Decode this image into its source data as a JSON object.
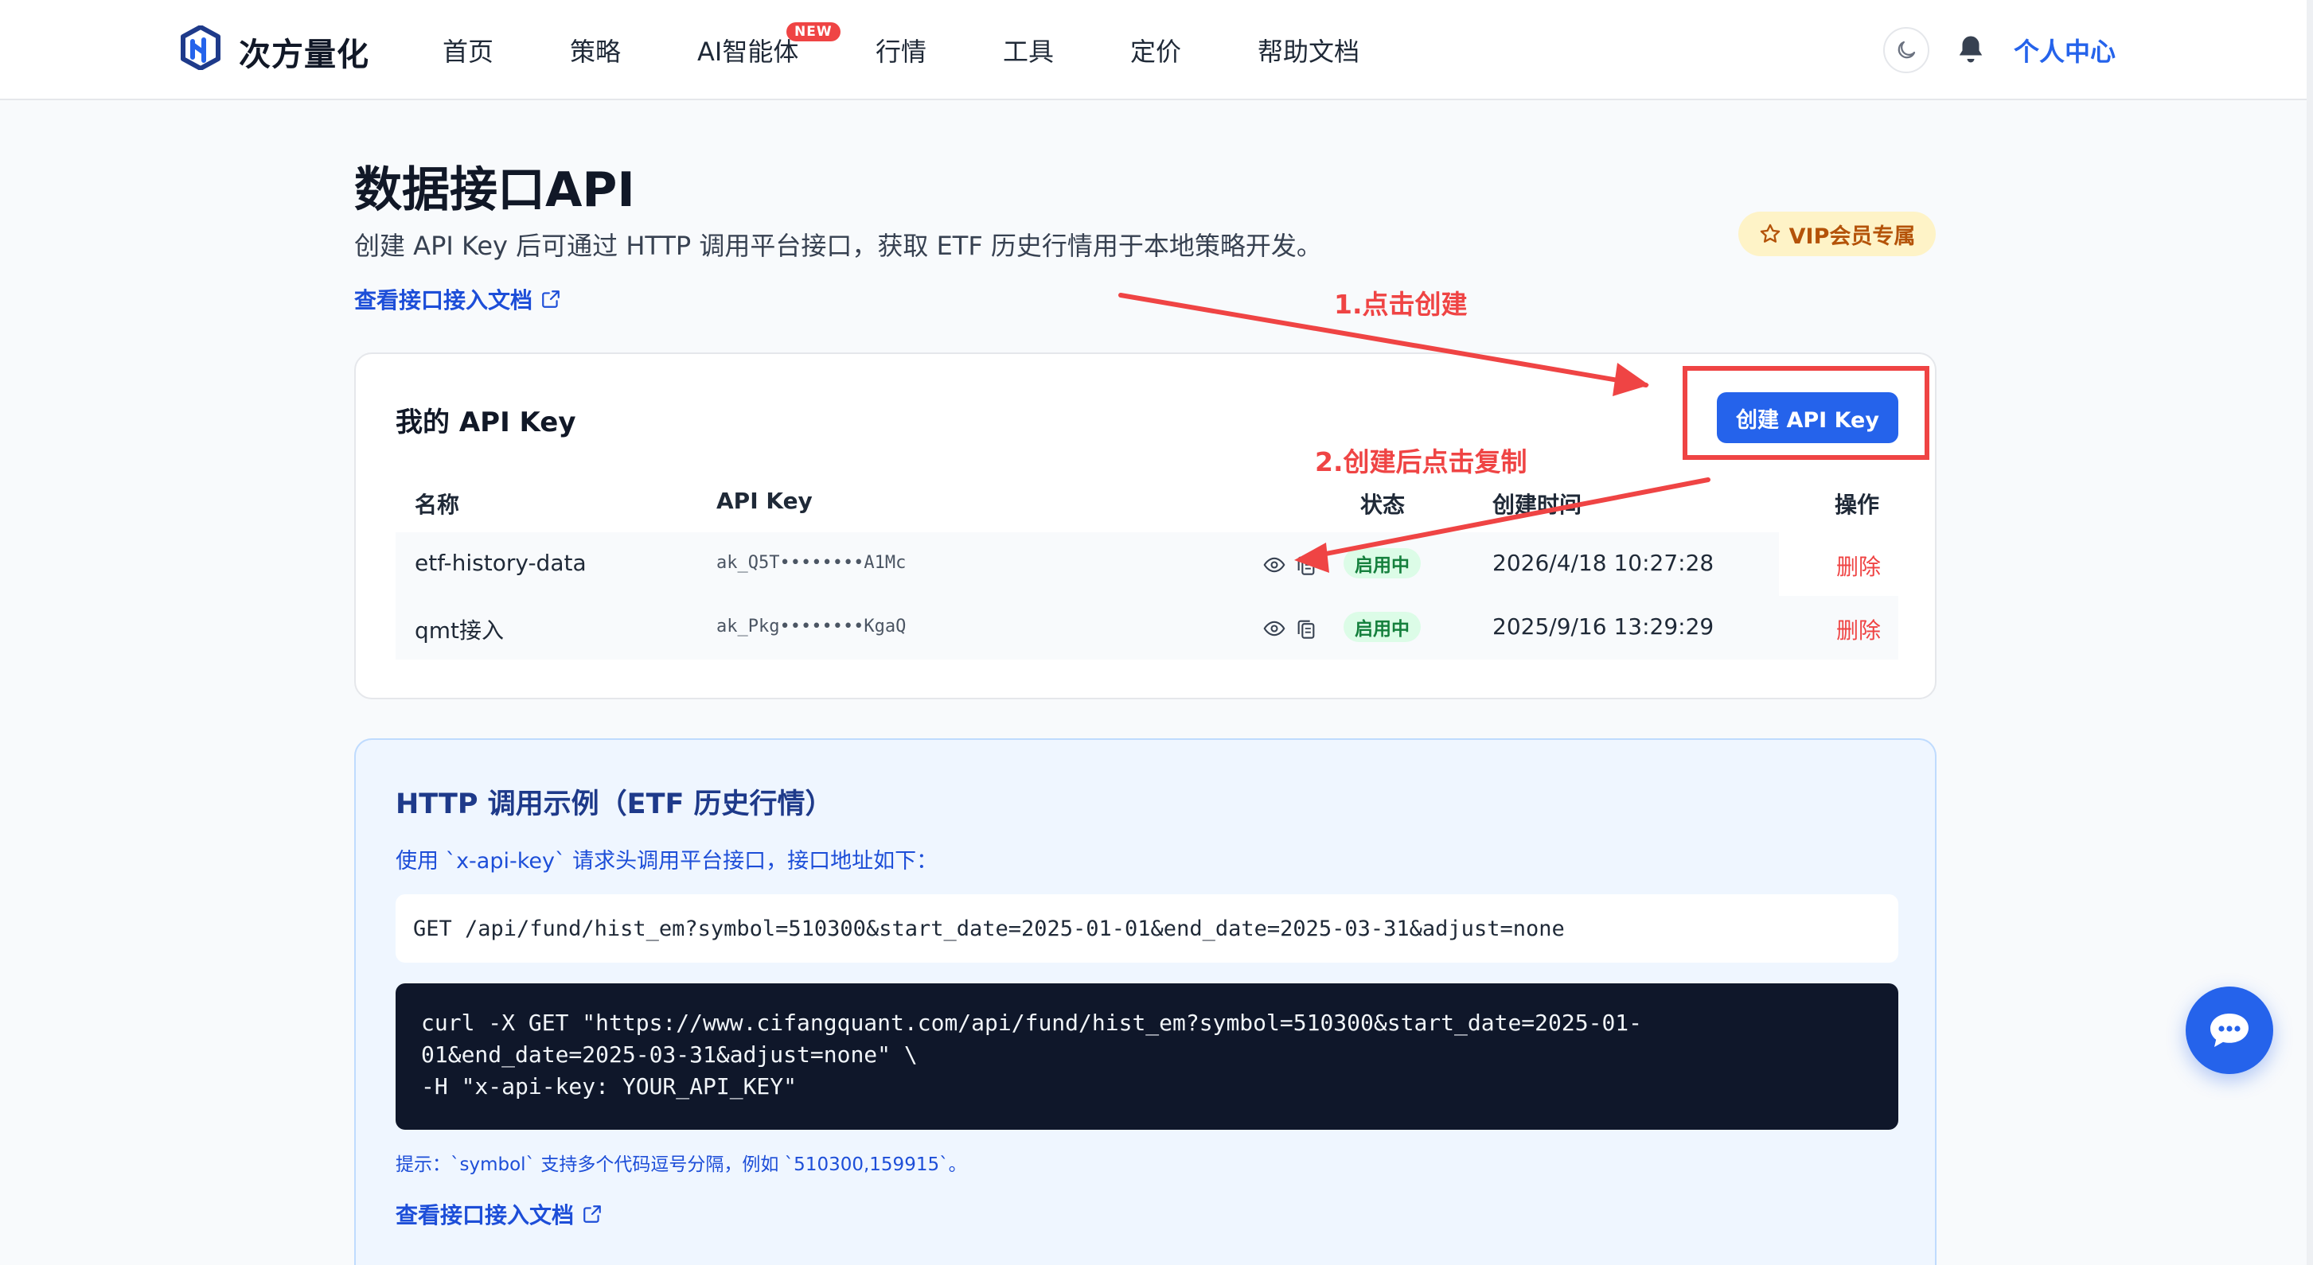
{
  "app": {
    "logo_text": "次方量化",
    "nav": {
      "home": "首页",
      "strategy": "策略",
      "ai_agent": "AI智能体",
      "ai_badge": "NEW",
      "market": "行情",
      "tools": "工具",
      "pricing": "定价",
      "help_docs": "帮助文档"
    },
    "user_center": "个人中心",
    "icons": {
      "theme": "moon-icon",
      "notifications": "bell-icon",
      "chat": "chat-bubble-icon"
    },
    "colors": {
      "primary": "#2563eb",
      "danger": "#ef4444",
      "success_bg": "#dcfce7",
      "success_text": "#15803d",
      "vip_bg": "#fef3c7",
      "vip_text": "#b45309",
      "code_bg": "#0f172a"
    }
  },
  "page": {
    "title": "数据接口API",
    "description": "创建 API Key 后可通过 HTTP 调用平台接口，获取 ETF 历史行情用于本地策略开发。",
    "doc_link": "查看接口接入文档",
    "vip_badge": "VIP会员专属"
  },
  "api_keys": {
    "title": "我的 API Key",
    "create_button": "创建 API Key",
    "columns": {
      "name": "名称",
      "api_key": "API Key",
      "status": "状态",
      "created_at": "创建时间",
      "actions": "操作"
    },
    "rows": [
      {
        "name": "etf-history-data",
        "key": "ak_Q5T••••••••A1Mc",
        "status": "启用中",
        "created_at": "2026/4/18 10:27:28",
        "action": "删除"
      },
      {
        "name": "qmt接入",
        "key": "ak_Pkg••••••••KgaQ",
        "status": "启用中",
        "created_at": "2025/9/16 13:29:29",
        "action": "删除"
      }
    ]
  },
  "http_example": {
    "title": "HTTP 调用示例（ETF 历史行情）",
    "description": "使用 `x-api-key` 请求头调用平台接口，接口地址如下：",
    "endpoint": "GET /api/fund/hist_em?symbol=510300&start_date=2025-01-01&end_date=2025-03-31&adjust=none",
    "curl_lines": [
      "curl -X GET \"https://www.cifangquant.com/api/fund/hist_em?symbol=510300&start_date=2025-01-",
      "01&end_date=2025-03-31&adjust=none\" \\",
      "-H \"x-api-key: YOUR_API_KEY\""
    ],
    "hint": "提示：`symbol` 支持多个代码逗号分隔，例如 `510300,159915`。",
    "doc_link": "查看接口接入文档"
  },
  "annotations": {
    "step1": "1.点击创建",
    "step2": "2.创建后点击复制"
  }
}
